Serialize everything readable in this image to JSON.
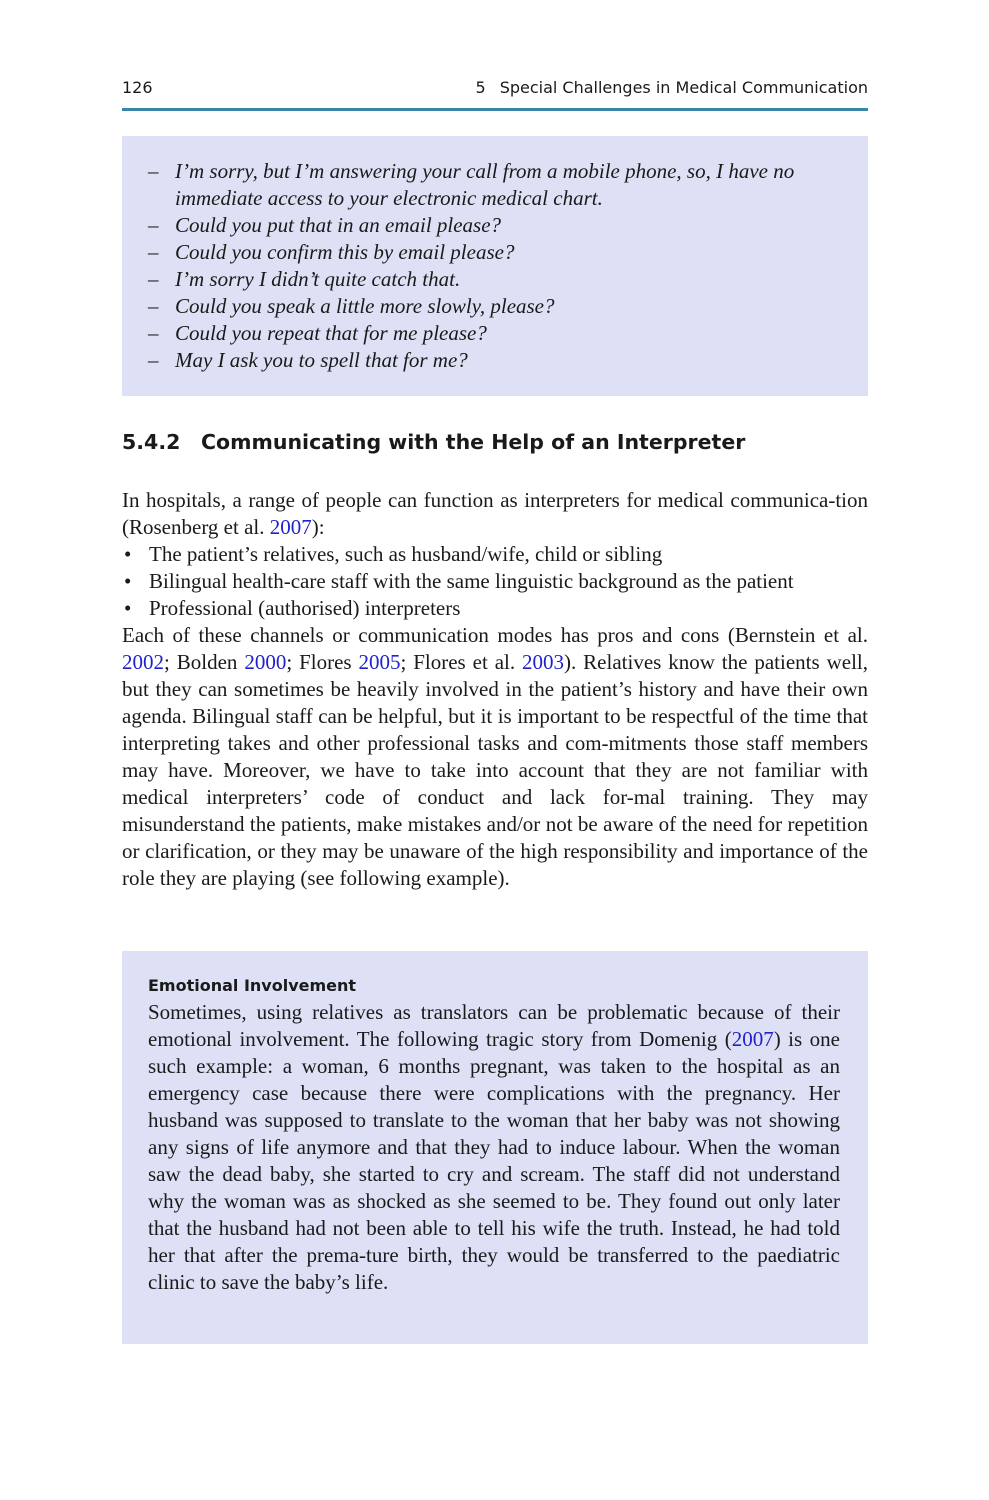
{
  "header": {
    "page_number": "126",
    "chapter_number": "5",
    "chapter_title": "Special Challenges in Medical Communication"
  },
  "phrase_box": {
    "dash": "–",
    "items": [
      "I’m sorry, but I’m answering your call from a mobile phone, so, I have no immediate access to your electronic medical chart.",
      "Could you put that in an email please?",
      "Could you confirm this by email please?",
      "I’m sorry I didn’t quite catch that.",
      "Could you speak a little more slowly, please?",
      "Could you repeat that for me please?",
      "May I ask you to spell that for me?"
    ]
  },
  "section": {
    "number": "5.4.2",
    "title": "Communicating with the Help of an Interpreter"
  },
  "intro": {
    "text_before": "In hospitals, a range of people can function as interpreters for medical communica-tion (Rosenberg et al. ",
    "cite": "2007",
    "text_after": "):",
    "bullet": "•",
    "bullets": [
      "The patient’s relatives, such as husband/wife, child or sibling",
      "Bilingual health-care staff with the same linguistic background as the patient",
      "Professional (authorised) interpreters"
    ]
  },
  "paragraph": {
    "t1": "Each of these channels or communication modes has pros and cons (Bernstein et al. ",
    "c1": "2002",
    "t2": "; Bolden ",
    "c2": "2000",
    "t3": "; Flores ",
    "c3": "2005",
    "t4": "; Flores et al. ",
    "c4": "2003",
    "t5": "). Relatives know the patients well, but they can sometimes be heavily involved in the patient’s history and have their own agenda. Bilingual staff can be helpful, but it is important to be respectful of the time that interpreting takes and other professional tasks and com-mitments those staff members may have. Moreover, we have to take into account that they are not familiar with medical interpreters’ code of conduct and lack for-mal training. They may misunderstand the patients, make mistakes and/or not be aware of the need for repetition or clarification, or they may be unaware of the high responsibility and importance of the role they are playing (see following example)."
  },
  "example_box": {
    "title": "Emotional Involvement",
    "t1": "Sometimes, using relatives as translators can be problematic because of their emotional involvement. The following tragic story from Domenig (",
    "cite": "2007",
    "t2": ") is one such example: a woman, 6 months pregnant, was taken to the hospital as an emergency case because there were complications with the pregnancy. Her husband was supposed to translate to the woman that her baby was not showing any signs of life anymore and that they had to induce labour. When the woman saw the dead baby, she started to cry and scream. The staff did not understand why the woman was as shocked as she seemed to be. They found out only later that the husband had not been able to tell his wife the truth. Instead, he had told her that after the prema-ture birth, they would be transferred to the paediatric clinic to save the baby’s life."
  }
}
